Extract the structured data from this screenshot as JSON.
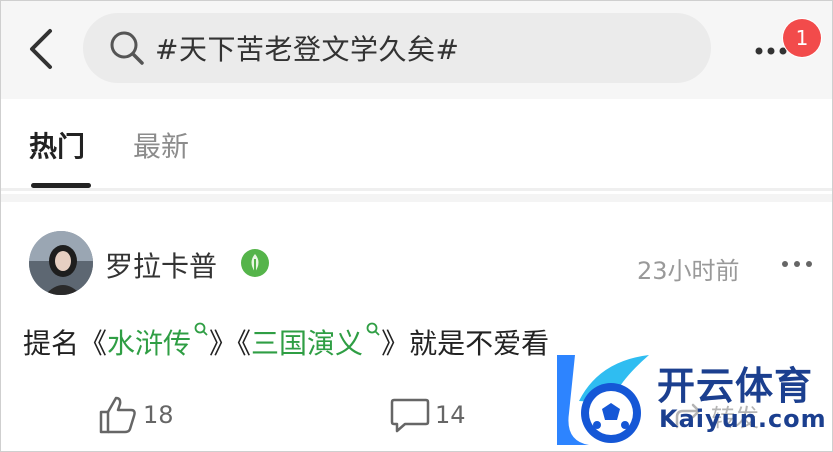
{
  "header": {
    "search": {
      "query": "#天下苦老登文学久矣#"
    },
    "notification_badge": "1"
  },
  "tabs": [
    {
      "label": "热门",
      "active": true
    },
    {
      "label": "最新",
      "active": false
    }
  ],
  "post": {
    "username": "罗拉卡普",
    "timestamp": "23小时前",
    "text": {
      "prefix": "提名《",
      "topic1": "水浒传",
      "middle": "》《",
      "topic2": "三国演义",
      "suffix": "》就是不爱看"
    },
    "actions": {
      "likes": "18",
      "comments": "14",
      "forward_label": "转发"
    }
  },
  "watermark": {
    "cn": "开云体育",
    "en": "Kaiyun.com"
  },
  "colors": {
    "accent_green": "#2f9e44",
    "badge_red": "#f24b4b",
    "watermark_blue": "#1b3f8f"
  }
}
